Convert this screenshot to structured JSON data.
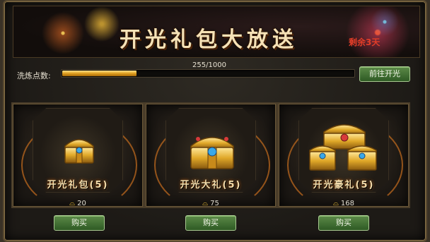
{
  "window": {
    "title": "开光礼包大放送",
    "days_left": "剩余3天"
  },
  "progress": {
    "label": "洗炼点数:",
    "text": "255/1000",
    "current": 255,
    "max": 1000,
    "goto_label": "前往开光"
  },
  "cards": [
    {
      "name": "开光礼包(5)",
      "price": "20",
      "buy_label": "购买",
      "icon": "treasure-chest-icon"
    },
    {
      "name": "开光大礼(5)",
      "price": "75",
      "buy_label": "购买",
      "icon": "treasure-chest-icon"
    },
    {
      "name": "开光豪礼(5)",
      "price": "168",
      "buy_label": "购买",
      "icon": "treasure-chests-icon"
    }
  ],
  "colors": {
    "accent_gold": "#e0a020",
    "button_green": "#2e5a24",
    "days_red": "#e23d28"
  }
}
